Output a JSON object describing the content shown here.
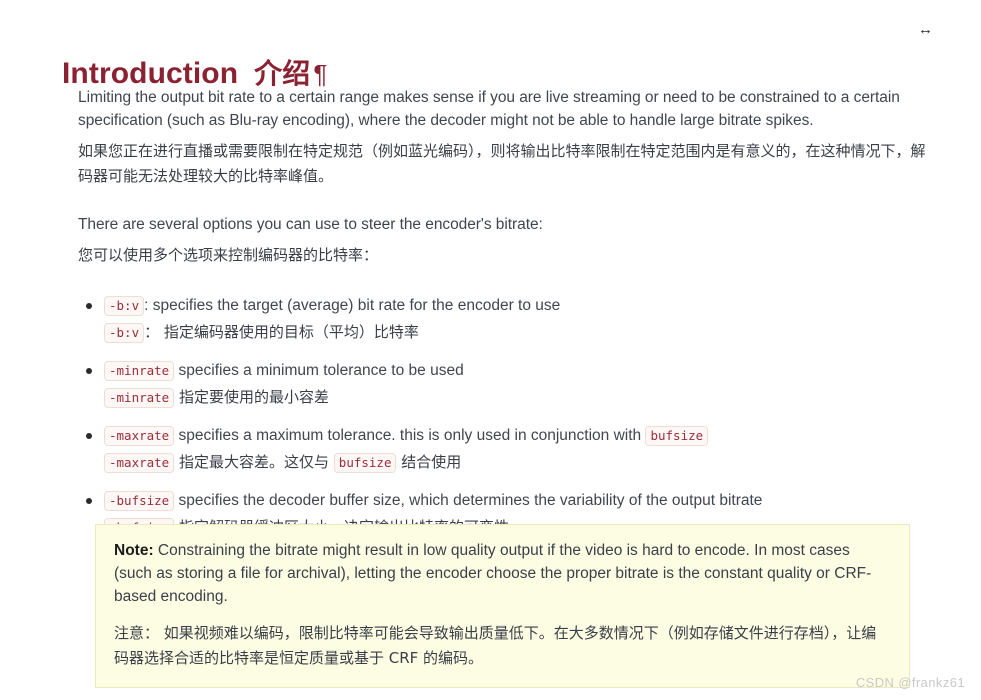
{
  "toolbar": {
    "resize_arrow_glyph": "↔",
    "resize_arrow_name": "horizontal-resize-icon"
  },
  "heading": {
    "title_en": "Introduction",
    "title_cn": "介绍",
    "anchor": "¶"
  },
  "intro": {
    "en": "Limiting the output bit rate to a certain range makes sense if you are live streaming or need to be constrained to a certain specification (such as Blu-ray encoding), where the decoder might not be able to handle large bitrate spikes.",
    "cn": "如果您正在进行直播或需要限制在特定规范（例如蓝光编码），则将输出比特率限制在特定范围内是有意义的，在这种情况下，解码器可能无法处理较大的比特率峰值。"
  },
  "options_intro": {
    "en": "There are several options you can use to steer the encoder's bitrate:",
    "cn": "您可以使用多个选项来控制编码器的比特率："
  },
  "options": [
    {
      "code": "-b:v",
      "en_text": ": specifies the target (average) bit rate for the encoder to use",
      "cn_code": "-b:v",
      "cn_text": "： 指定编码器使用的目标（平均）比特率"
    },
    {
      "code": "-minrate",
      "en_text": "specifies a minimum tolerance to be used",
      "cn_code": "-minrate",
      "cn_text": "指定要使用的最小容差"
    },
    {
      "code": "-maxrate",
      "en_text": "specifies a maximum tolerance. this is only used in conjunction with",
      "en_text_2": "",
      "en_code_2": "bufsize",
      "cn_code": "-maxrate",
      "cn_text": "指定最大容差。这仅与",
      "cn_code_2": "bufsize",
      "cn_text_2": "结合使用"
    },
    {
      "code": "-bufsize",
      "en_text": "specifies the decoder buffer size, which determines the variability of the output bitrate",
      "cn_code": "-bufsize",
      "cn_text": "指定解码器缓冲区大小，决定输出比特率的可变性"
    }
  ],
  "note": {
    "label": "Note:",
    "en": " Constraining the bitrate might result in low quality output if the video is hard to encode. In most cases (such as storing a file for archival), letting the encoder choose the proper bitrate is the constant quality or CRF-based encoding.",
    "cn": "注意： 如果视频难以编码，限制比特率可能会导致输出质量低下。在大多数情况下（例如存储文件进行存档），让编码器选择合适的比特率是恒定质量或基于 CRF 的编码。"
  },
  "watermark": {
    "text": "CSDN @frankz61"
  },
  "colors": {
    "heading": "#8b2231",
    "code_text": "#9c2c3a",
    "code_bg": "#fdf8f6",
    "code_border": "#f0ddd4",
    "note_bg": "#fdfde4",
    "note_border": "#ebebbe",
    "body_text": "#40464f",
    "watermark": "#c9c9c9"
  }
}
